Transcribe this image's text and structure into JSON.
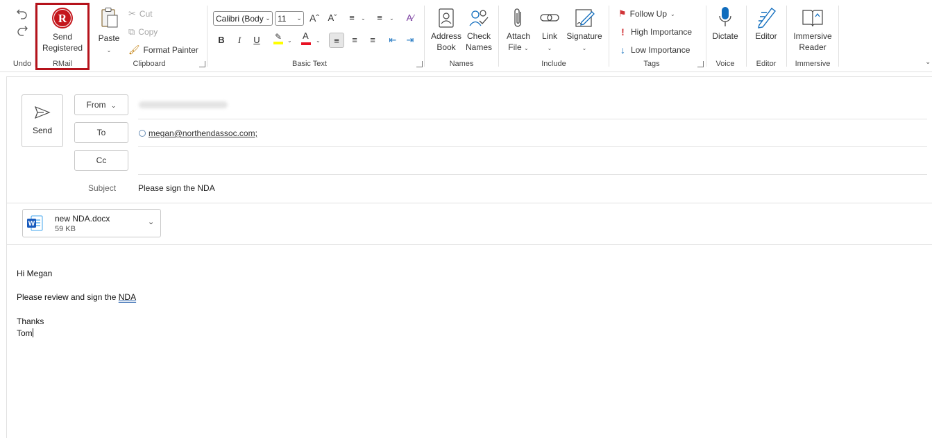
{
  "ribbon": {
    "undo": {
      "group": "Undo"
    },
    "rmail": {
      "line1": "Send",
      "line2": "Registered",
      "group": "RMail",
      "highlight_color": "#b5121b"
    },
    "clipboard": {
      "paste": "Paste",
      "cut": "Cut",
      "copy": "Copy",
      "format_painter": "Format Painter",
      "group": "Clipboard"
    },
    "basic_text": {
      "font": "Calibri (Body",
      "size": "11",
      "group": "Basic Text"
    },
    "names": {
      "address_line1": "Address",
      "address_line2": "Book",
      "check_line1": "Check",
      "check_line2": "Names",
      "group": "Names"
    },
    "include": {
      "attach_line1": "Attach",
      "attach_line2": "File",
      "link": "Link",
      "signature": "Signature",
      "group": "Include"
    },
    "tags": {
      "follow_up": "Follow Up",
      "high": "High Importance",
      "low": "Low Importance",
      "group": "Tags"
    },
    "voice": {
      "dictate": "Dictate",
      "group": "Voice"
    },
    "editor": {
      "editor": "Editor",
      "group": "Editor"
    },
    "immersive": {
      "line1": "Immersive",
      "line2": "Reader",
      "group": "Immersive"
    }
  },
  "compose": {
    "send": "Send",
    "from": "From",
    "to": "To",
    "cc": "Cc",
    "to_value": "megan@northendassoc.com;",
    "subject_label": "Subject",
    "subject_value": "Please sign the NDA",
    "attachment": {
      "name": "new NDA.docx",
      "size": "59 KB"
    },
    "body": {
      "greeting": "Hi Megan",
      "line1_prefix": "Please review and sign the ",
      "line1_word": "NDA",
      "thanks": "Thanks",
      "name": "Tom"
    }
  },
  "colors": {
    "accent": "#0f6cbd",
    "rmail_red": "#c4161c",
    "highlight": "#ffff00",
    "font_color": "#e81123"
  }
}
